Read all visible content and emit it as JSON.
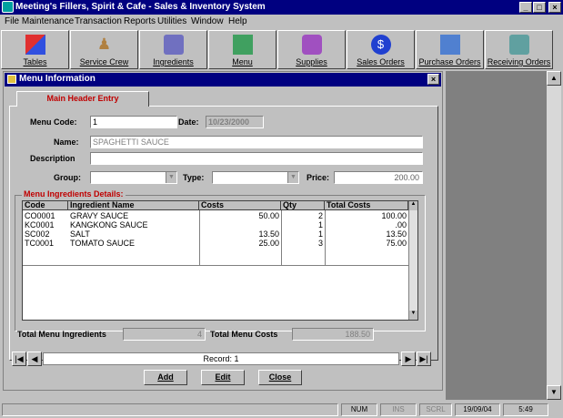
{
  "window": {
    "title": "Meeting's Fillers, Spirit & Cafe - Sales & Inventory System"
  },
  "menubar": [
    "File Maintenance",
    "Transaction",
    "Reports",
    "Utilities",
    "Window",
    "Help"
  ],
  "toolbar": [
    {
      "label": "Tables",
      "icon": "tables-icon"
    },
    {
      "label": "Service Crew",
      "icon": "service-crew-icon"
    },
    {
      "label": "Ingredients",
      "icon": "ingredients-icon"
    },
    {
      "label": "Menu",
      "icon": "menu-icon"
    },
    {
      "label": "Supplies",
      "icon": "supplies-icon"
    },
    {
      "label": "Sales Orders",
      "icon": "sales-orders-icon"
    },
    {
      "label": "Purchase Orders",
      "icon": "purchase-orders-icon"
    },
    {
      "label": "Receiving Orders",
      "icon": "receiving-orders-icon"
    }
  ],
  "child": {
    "title": "Menu Information",
    "tab": "Main Header Entry",
    "labels": {
      "menu_code": "Menu Code:",
      "date": "Date:",
      "name": "Name:",
      "description": "Description",
      "group": "Group:",
      "type": "Type:",
      "price": "Price:"
    },
    "values": {
      "menu_code": "1",
      "date": "10/23/2000",
      "name": "SPAGHETTI SAUCE",
      "description": "",
      "group": "",
      "type": "",
      "price": "200.00"
    },
    "ingredients_title": "Menu Ingredients Details:",
    "columns": [
      "Code",
      "Ingredient Name",
      "Costs",
      "Qty",
      "Total Costs"
    ],
    "rows": [
      [
        "CO0001",
        "GRAVY SAUCE",
        "50.00",
        "2",
        "100.00"
      ],
      [
        "KC0001",
        "KANGKONG SAUCE",
        "",
        "1",
        ".00"
      ],
      [
        "SC002",
        "SALT",
        "13.50",
        "1",
        "13.50"
      ],
      [
        "TC0001",
        "TOMATO SAUCE",
        "25.00",
        "3",
        "75.00"
      ]
    ],
    "totals": {
      "ingredients_label": "Total Menu Ingredients",
      "ingredients_value": "4",
      "costs_label": "Total Menu Costs",
      "costs_value": "188.50"
    },
    "record_text": "Record: 1",
    "buttons": {
      "add": "Add",
      "edit": "Edit",
      "close": "Close"
    }
  },
  "status": {
    "num": "NUM",
    "ins": "INS",
    "scrl": "SCRL",
    "date": "19/09/04",
    "time": "5:49"
  }
}
